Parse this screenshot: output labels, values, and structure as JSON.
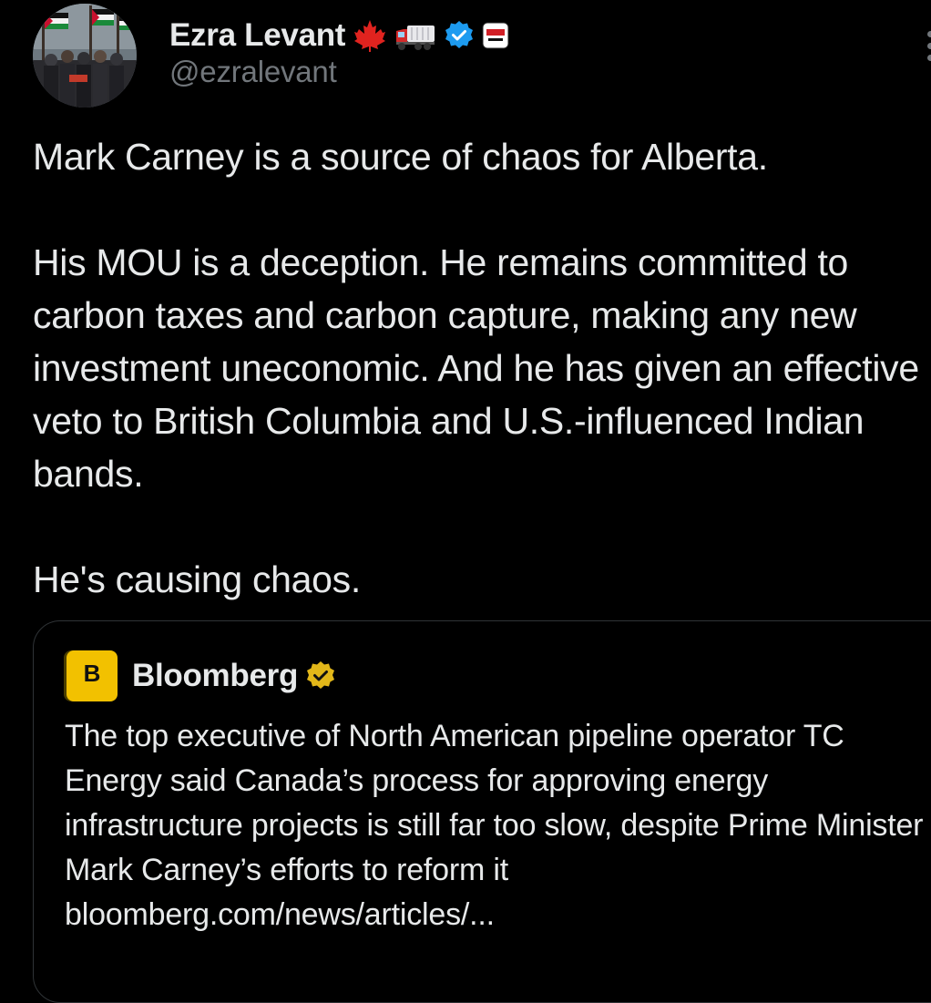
{
  "author": {
    "display_name": "Ezra Levant",
    "handle": "@ezralevant",
    "badges": [
      "maple-leaf-icon",
      "truck-icon",
      "verified-badge-icon",
      "rebel-news-logo-icon"
    ],
    "avatar": "protest-crowd-photo-avatar"
  },
  "tweet": {
    "paragraphs": [
      "Mark Carney is a source of chaos for Alberta.",
      "His MOU is a deception. He remains committed to carbon taxes and carbon capture, making any new investment uneconomic. And he has given an effective veto to British Columbia and U.S.-influenced Indian bands.",
      "He's causing chaos."
    ]
  },
  "quote": {
    "author_name": "Bloomberg",
    "avatar_letter": "B",
    "badge": "gold-verified-badge-icon",
    "text": "The top executive of North American pipeline operator TC Energy said Canada’s process for approving energy infrastructure projects is still far too slow, despite Prime Minister Mark Carney’s efforts to reform it",
    "link": "bloomberg.com/news/articles/..."
  },
  "colors": {
    "background": "#000000",
    "text": "#e7e9ea",
    "secondary_text": "#71767b",
    "verified_blue": "#1d9bf0",
    "verified_gold": "#e2b719",
    "bloomberg_yellow": "#f2c100",
    "border": "#2f3336"
  }
}
